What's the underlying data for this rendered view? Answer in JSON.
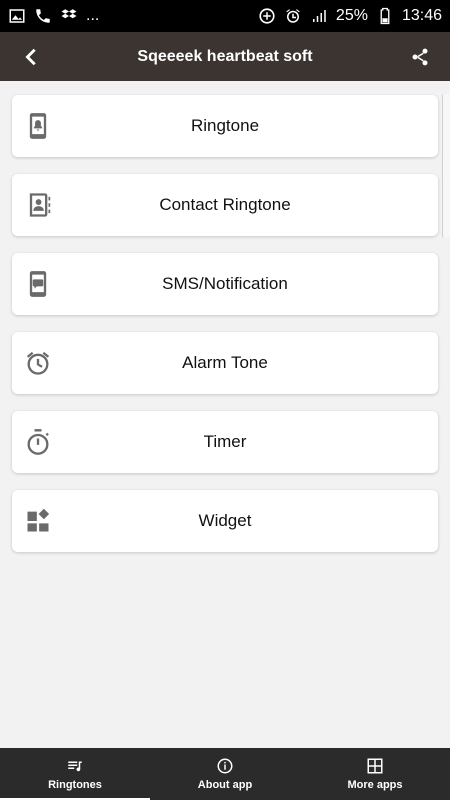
{
  "status_bar": {
    "more": "...",
    "battery": "25%",
    "time": "13:46"
  },
  "app_bar": {
    "title": "Sqeeeek heartbeat soft"
  },
  "menu": [
    {
      "label": "Ringtone",
      "icon": "phone-bell-icon"
    },
    {
      "label": "Contact Ringtone",
      "icon": "contact-book-icon"
    },
    {
      "label": "SMS/Notification",
      "icon": "phone-message-icon"
    },
    {
      "label": "Alarm Tone",
      "icon": "alarm-clock-icon"
    },
    {
      "label": "Timer",
      "icon": "stopwatch-icon"
    },
    {
      "label": "Widget",
      "icon": "widget-icon"
    }
  ],
  "bottom_nav": [
    {
      "label": "Ringtones",
      "icon": "music-list-icon",
      "active": true
    },
    {
      "label": "About app",
      "icon": "info-icon",
      "active": false
    },
    {
      "label": "More apps",
      "icon": "grid-icon",
      "active": false
    }
  ]
}
